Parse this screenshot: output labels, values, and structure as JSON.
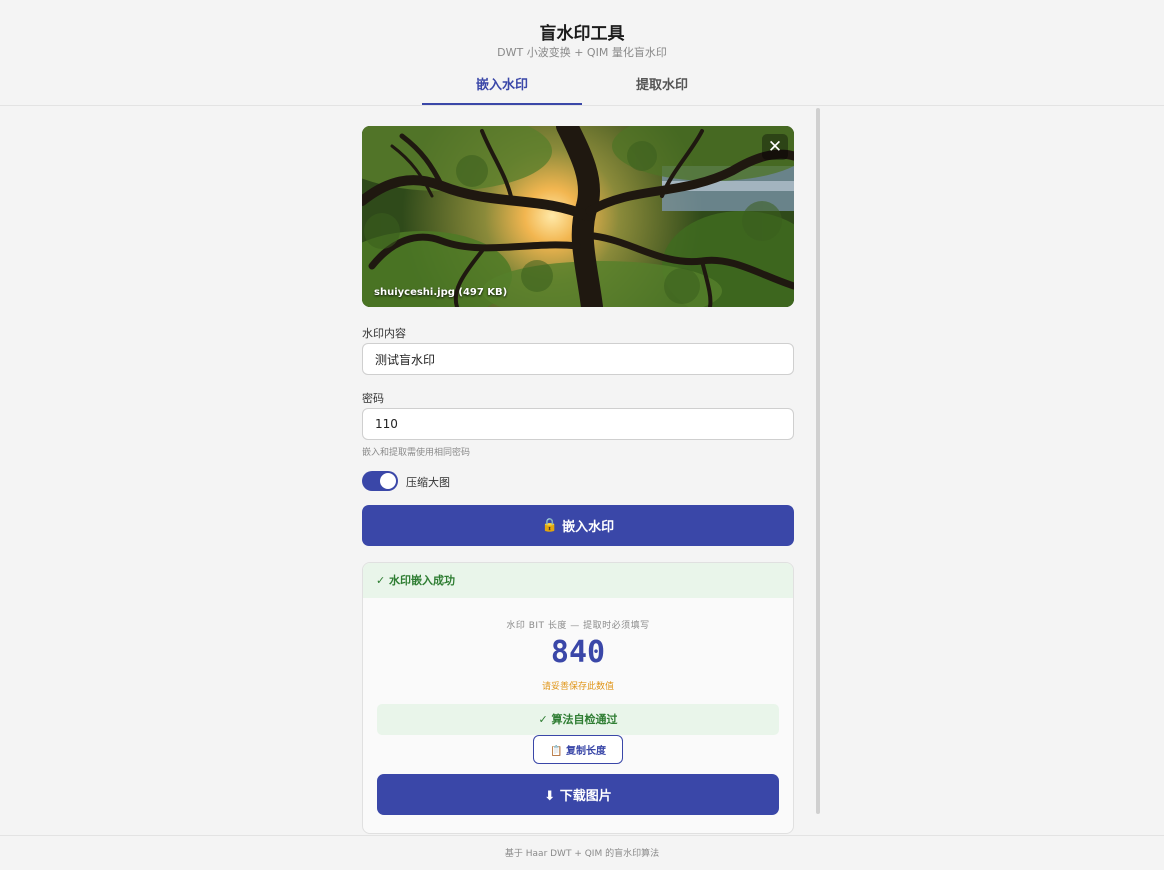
{
  "app": {
    "title": "盲水印工具",
    "subtitle": "DWT 小波变换 + QIM 量化盲水印"
  },
  "tabs": [
    {
      "label": "嵌入水印",
      "active": true
    },
    {
      "label": "提取水印",
      "active": false
    }
  ],
  "preview": {
    "file_caption": "shuiyceshi.jpg (497 KB)",
    "close_glyph": "✕"
  },
  "form": {
    "watermark_label": "水印内容",
    "watermark_value": "测试盲水印",
    "password_label": "密码",
    "password_value": "110",
    "password_hint": "嵌入和提取需使用相同密码",
    "compress_label": "压缩大图",
    "compress_enabled": true
  },
  "embed_button": {
    "icon": "🔒",
    "label": "嵌入水印"
  },
  "result": {
    "success_text": "✓ 水印嵌入成功",
    "bit_caption": "水印 BIT 长度 — 提取时必须填写",
    "bit_value": "840",
    "bit_warning": "请妥善保存此数值",
    "selfcheck_text": "✓ 算法自检通过",
    "copy_button": "📋 复制长度",
    "download_button": "⬇ 下载图片"
  },
  "footer": {
    "text": "基于 Haar DWT + QIM 的盲水印算法"
  },
  "colors": {
    "accent": "#3a47a8",
    "success": "#2e7d32",
    "success_bg": "#e9f5ea",
    "warning": "#e0961a"
  }
}
